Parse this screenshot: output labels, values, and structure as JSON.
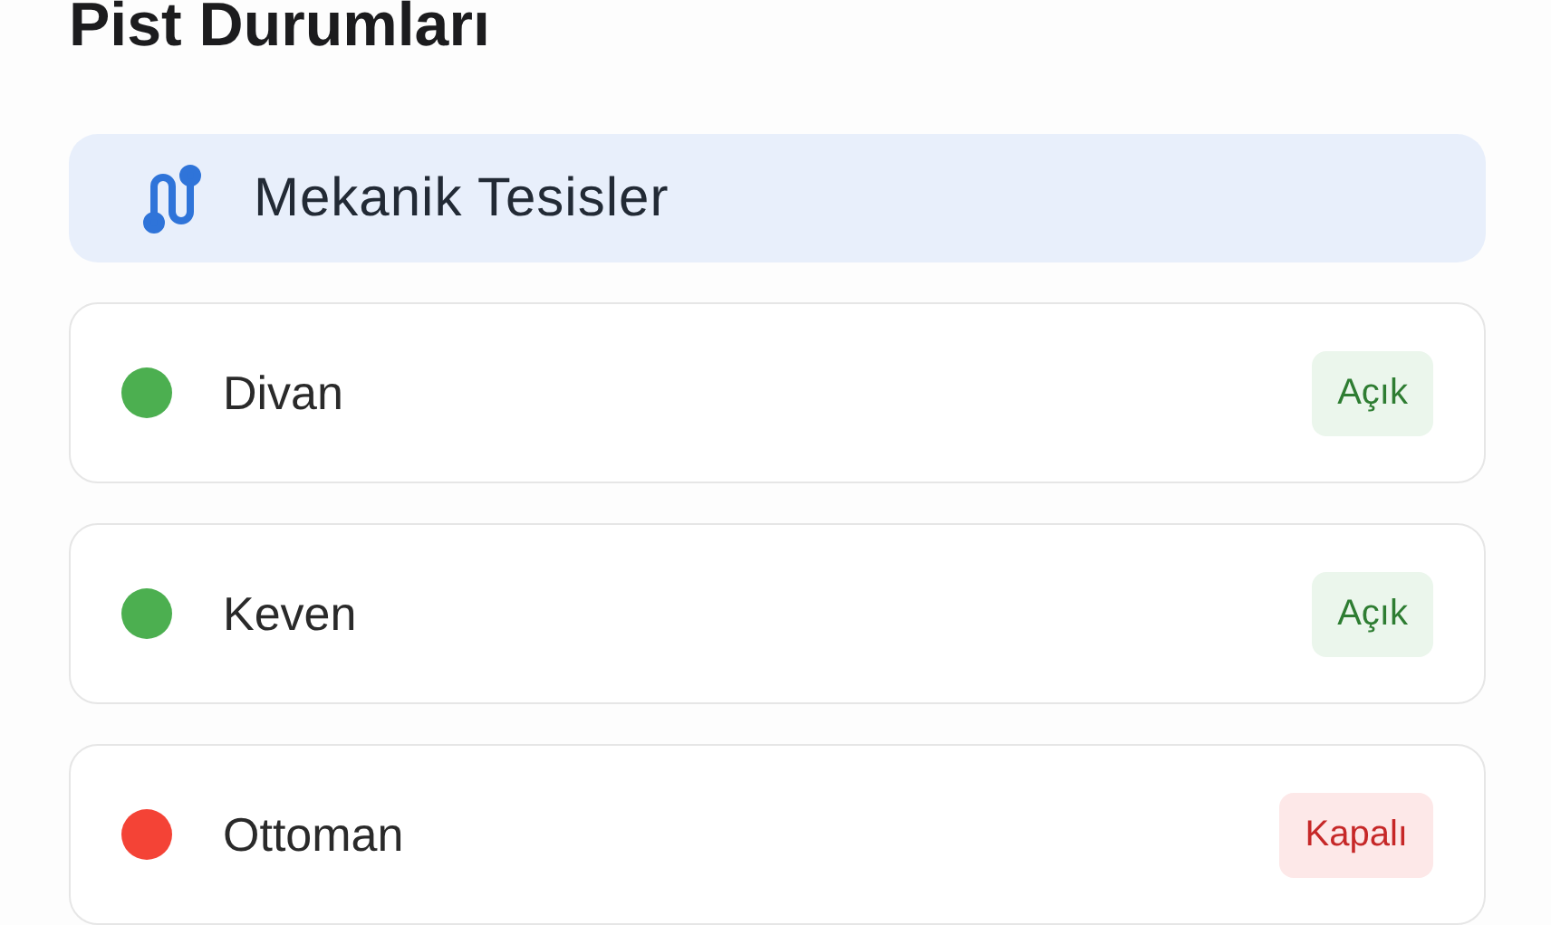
{
  "title": "Pist Durumları",
  "section": {
    "title": "Mekanik Tesisler"
  },
  "lifts": [
    {
      "name": "Divan",
      "color": "#4caf50",
      "status": {
        "kind": "open",
        "label": "Açık"
      }
    },
    {
      "name": "Keven",
      "color": "#4caf50",
      "status": {
        "kind": "open",
        "label": "Açık"
      }
    },
    {
      "name": "Ottoman",
      "color": "#f44336",
      "status": {
        "kind": "closed",
        "label": "Kapalı"
      }
    }
  ]
}
